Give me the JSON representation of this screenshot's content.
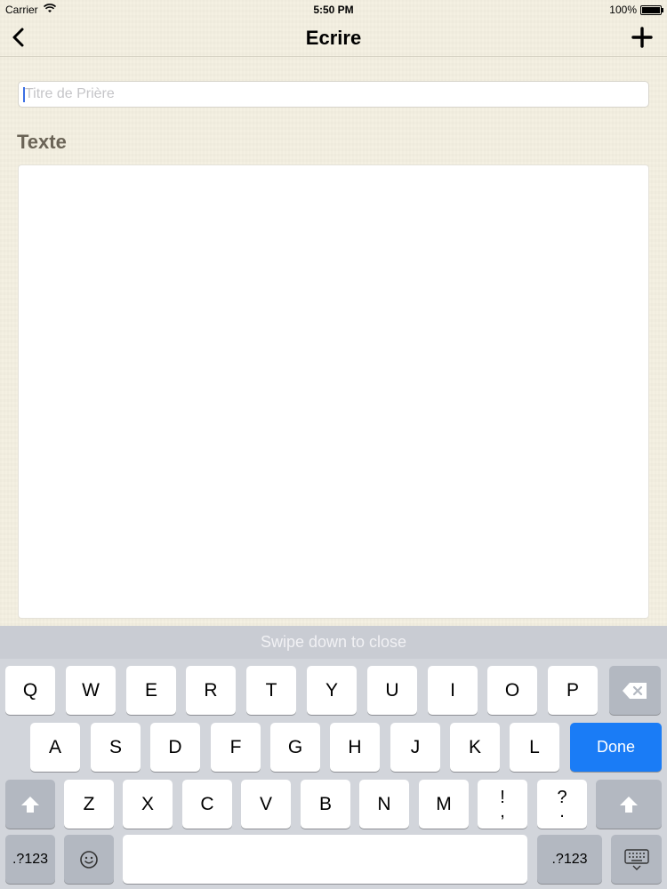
{
  "status_bar": {
    "carrier": "Carrier",
    "time": "5:50 PM",
    "battery": "100%"
  },
  "nav": {
    "title": "Ecrire",
    "back_icon": "chevron-left-icon",
    "add_icon": "plus-icon"
  },
  "form": {
    "title_placeholder": "Titre de Prière",
    "title_value": "",
    "text_label": "Texte",
    "text_value": ""
  },
  "keyboard": {
    "swipe_hint": "Swipe down to close",
    "row1": [
      "Q",
      "W",
      "E",
      "R",
      "T",
      "Y",
      "U",
      "I",
      "O",
      "P"
    ],
    "row2": [
      "A",
      "S",
      "D",
      "F",
      "G",
      "H",
      "J",
      "K",
      "L"
    ],
    "row3": [
      "Z",
      "X",
      "C",
      "V",
      "B",
      "N",
      "M"
    ],
    "punct1_top": "!",
    "punct1_bottom": ",",
    "punct2_top": "?",
    "punct2_bottom": ".",
    "done": "Done",
    "numbers_left": ".?123",
    "numbers_right": ".?123",
    "accent_color": "#1a7cf6"
  }
}
